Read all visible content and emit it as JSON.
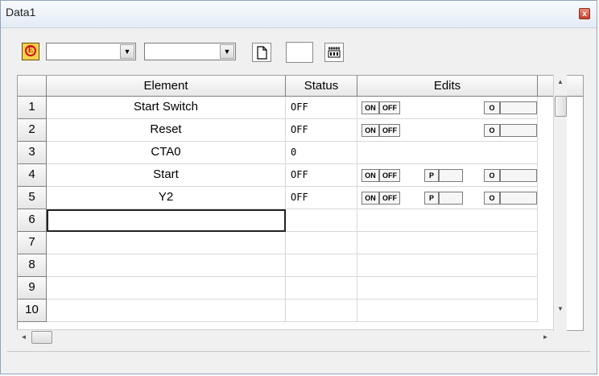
{
  "window": {
    "title": "Data1",
    "close_glyph": "x"
  },
  "toolbar": {
    "e_glyph": "E",
    "combo1_value": "",
    "combo2_value": "",
    "dropdown_glyph": "▼"
  },
  "grid": {
    "headers": {
      "element": "Element",
      "status": "Status",
      "edits": "Edits"
    },
    "rows": [
      {
        "num": "1",
        "element": "Start Switch",
        "status": "OFF",
        "edits": "onoff_o"
      },
      {
        "num": "2",
        "element": "Reset",
        "status": "OFF",
        "edits": "onoff_o"
      },
      {
        "num": "3",
        "element": "CTA0",
        "status": "0",
        "edits": "none"
      },
      {
        "num": "4",
        "element": "Start",
        "status": "OFF",
        "edits": "onoff_p_o"
      },
      {
        "num": "5",
        "element": "Y2",
        "status": "OFF",
        "edits": "onoff_p_o"
      },
      {
        "num": "6",
        "element": "",
        "status": "",
        "edits": "none"
      },
      {
        "num": "7",
        "element": "",
        "status": "",
        "edits": "none"
      },
      {
        "num": "8",
        "element": "",
        "status": "",
        "edits": "none"
      },
      {
        "num": "9",
        "element": "",
        "status": "",
        "edits": "none"
      },
      {
        "num": "10",
        "element": "",
        "status": "",
        "edits": "none"
      }
    ],
    "edit_labels": {
      "on": "ON",
      "off": "OFF",
      "p": "P",
      "o": "O"
    }
  },
  "scroll": {
    "up": "▲",
    "down": "▼",
    "left": "◄",
    "right": "►"
  }
}
